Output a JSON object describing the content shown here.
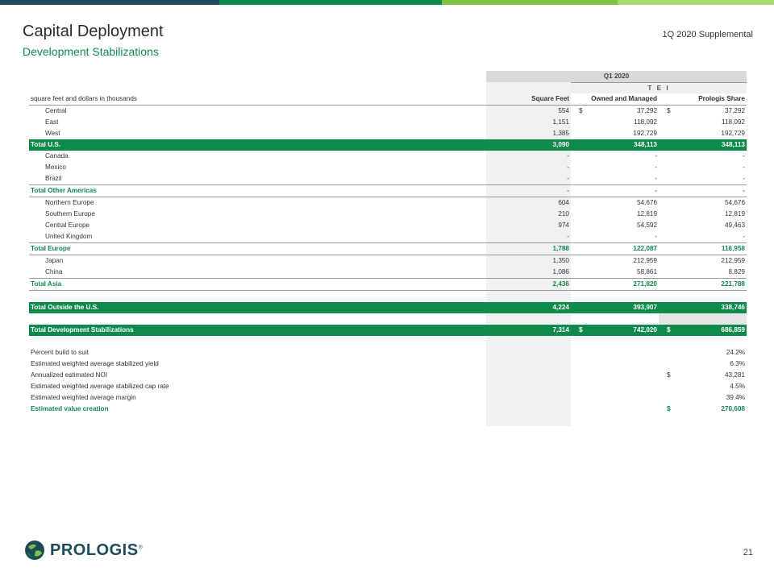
{
  "colors": {
    "accent": "#0e8a4d",
    "topbar": [
      "#1e4b5a",
      "#0e8a4d",
      "#7dc242",
      "#a6d86e"
    ]
  },
  "header": {
    "title": "Capital Deployment",
    "subtitle": "Development Stabilizations",
    "supplemental": "1Q 2020 Supplemental"
  },
  "table": {
    "period": "Q1 2020",
    "group": "T E I",
    "units_label": "square feet and dollars in thousands",
    "col_square_feet": "Square Feet",
    "col_owned": "Owned and Managed",
    "col_share": "Prologis Share",
    "rows": {
      "central": {
        "label": "Central",
        "sf": "554",
        "om": "37,292",
        "ps": "37,292",
        "d1": "$",
        "d2": "$"
      },
      "east": {
        "label": "East",
        "sf": "1,151",
        "om": "118,092",
        "ps": "118,092"
      },
      "west": {
        "label": "West",
        "sf": "1,385",
        "om": "192,729",
        "ps": "192,729"
      },
      "total_us": {
        "label": "Total U.S.",
        "sf": "3,090",
        "om": "348,113",
        "ps": "348,113"
      },
      "canada": {
        "label": "Canada",
        "sf": "-",
        "om": "-",
        "ps": "-"
      },
      "mexico": {
        "label": "Mexico",
        "sf": "-",
        "om": "-",
        "ps": "-"
      },
      "brazil": {
        "label": "Brazil",
        "sf": "-",
        "om": "-",
        "ps": "-"
      },
      "total_other_americas": {
        "label": "Total Other Americas",
        "sf": "-",
        "om": "-",
        "ps": "-"
      },
      "northern_europe": {
        "label": "Northern Europe",
        "sf": "604",
        "om": "54,676",
        "ps": "54,676"
      },
      "southern_europe": {
        "label": "Southern Europe",
        "sf": "210",
        "om": "12,819",
        "ps": "12,819"
      },
      "central_europe": {
        "label": "Central Europe",
        "sf": "974",
        "om": "54,592",
        "ps": "49,463"
      },
      "united_kingdom": {
        "label": "United Kingdom",
        "sf": "-",
        "om": "-",
        "ps": "-"
      },
      "total_europe": {
        "label": "Total Europe",
        "sf": "1,788",
        "om": "122,087",
        "ps": "116,958"
      },
      "japan": {
        "label": "Japan",
        "sf": "1,350",
        "om": "212,959",
        "ps": "212,959"
      },
      "china": {
        "label": "China",
        "sf": "1,086",
        "om": "58,861",
        "ps": "8,829"
      },
      "total_asia": {
        "label": "Total Asia",
        "sf": "2,436",
        "om": "271,820",
        "ps": "221,788"
      },
      "total_outside_us": {
        "label": "Total Outside the U.S.",
        "sf": "4,224",
        "om": "393,907",
        "ps": "338,746"
      },
      "total_dev_stab": {
        "label": "Total Development Stabilizations",
        "sf": "7,314",
        "om": "742,020",
        "ps": "686,859",
        "d1": "$",
        "d2": "$"
      }
    },
    "metrics": {
      "pct_bts": {
        "label": "Percent build to suit",
        "value": "24.2%"
      },
      "yield": {
        "label": "Estimated weighted average stabilized yield",
        "value": "6.3%"
      },
      "noi": {
        "label": "Annualized estimated NOI",
        "value": "43,281",
        "dollar": "$"
      },
      "cap_rate": {
        "label": "Estimated weighted average stabilized cap rate",
        "value": "4.5%"
      },
      "margin": {
        "label": "Estimated weighted average margin",
        "value": "39.4%"
      },
      "value_creation": {
        "label": "Estimated value creation",
        "value": "270,608",
        "dollar": "$"
      }
    }
  },
  "footer": {
    "logo_text": "PROLOGIS",
    "logo_mark": "®",
    "page_number": "21"
  }
}
